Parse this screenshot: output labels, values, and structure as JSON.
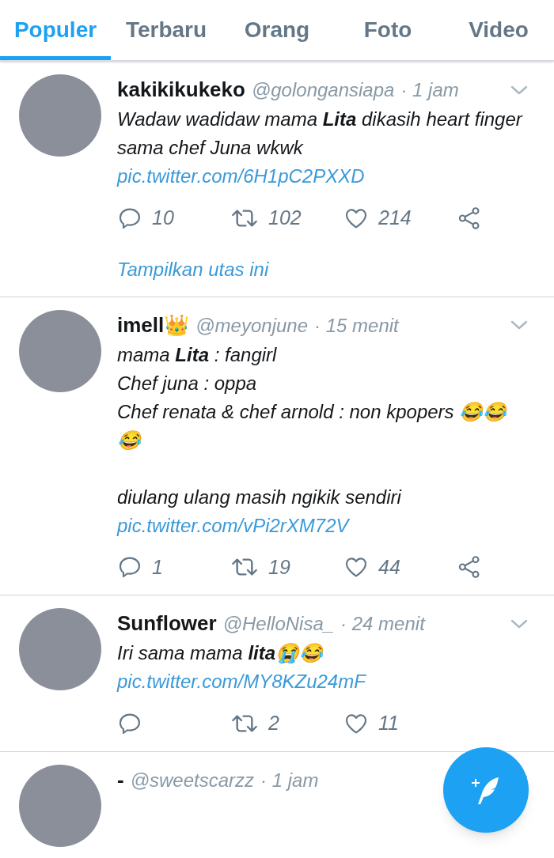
{
  "tabs": [
    {
      "label": "Populer",
      "selected": true
    },
    {
      "label": "Terbaru",
      "selected": false
    },
    {
      "label": "Orang",
      "selected": false
    },
    {
      "label": "Foto",
      "selected": false
    },
    {
      "label": "Video",
      "selected": false
    }
  ],
  "tweets": [
    {
      "name": "kakikikukeko",
      "handle": "@golongansiapa",
      "time": "· 1 jam",
      "paragraphs": [
        "Wadaw wadidaw mama **Lita** dikasih heart finger sama chef Juna wkwk"
      ],
      "link": "pic.twitter.com/6H1pC2PXXD",
      "stats": {
        "replies": "10",
        "retweets": "102",
        "likes": "214"
      },
      "show_thread": "Tampilkan utas ini"
    },
    {
      "name": "imell👑",
      "handle": "@meyonjune",
      "time": "· 15 menit",
      "paragraphs": [
        "mama **Lita** : fangirl\nChef juna : oppa\nChef renata & chef arnold : non kpopers 😂😂😂",
        "diulang ulang masih ngikik sendiri"
      ],
      "link": "pic.twitter.com/vPi2rXM72V",
      "stats": {
        "replies": "1",
        "retweets": "19",
        "likes": "44"
      }
    },
    {
      "name": "Sunflower",
      "handle": "@HelloNisa_",
      "time": "· 24 menit",
      "paragraphs": [
        "Iri sama mama **lita**😭😂"
      ],
      "link": "pic.twitter.com/MY8KZu24mF",
      "stats": {
        "retweets": "2",
        "likes": "11"
      }
    },
    {
      "name": "-",
      "handle": "@sweetscarzz",
      "time": "· 1 jam"
    }
  ]
}
